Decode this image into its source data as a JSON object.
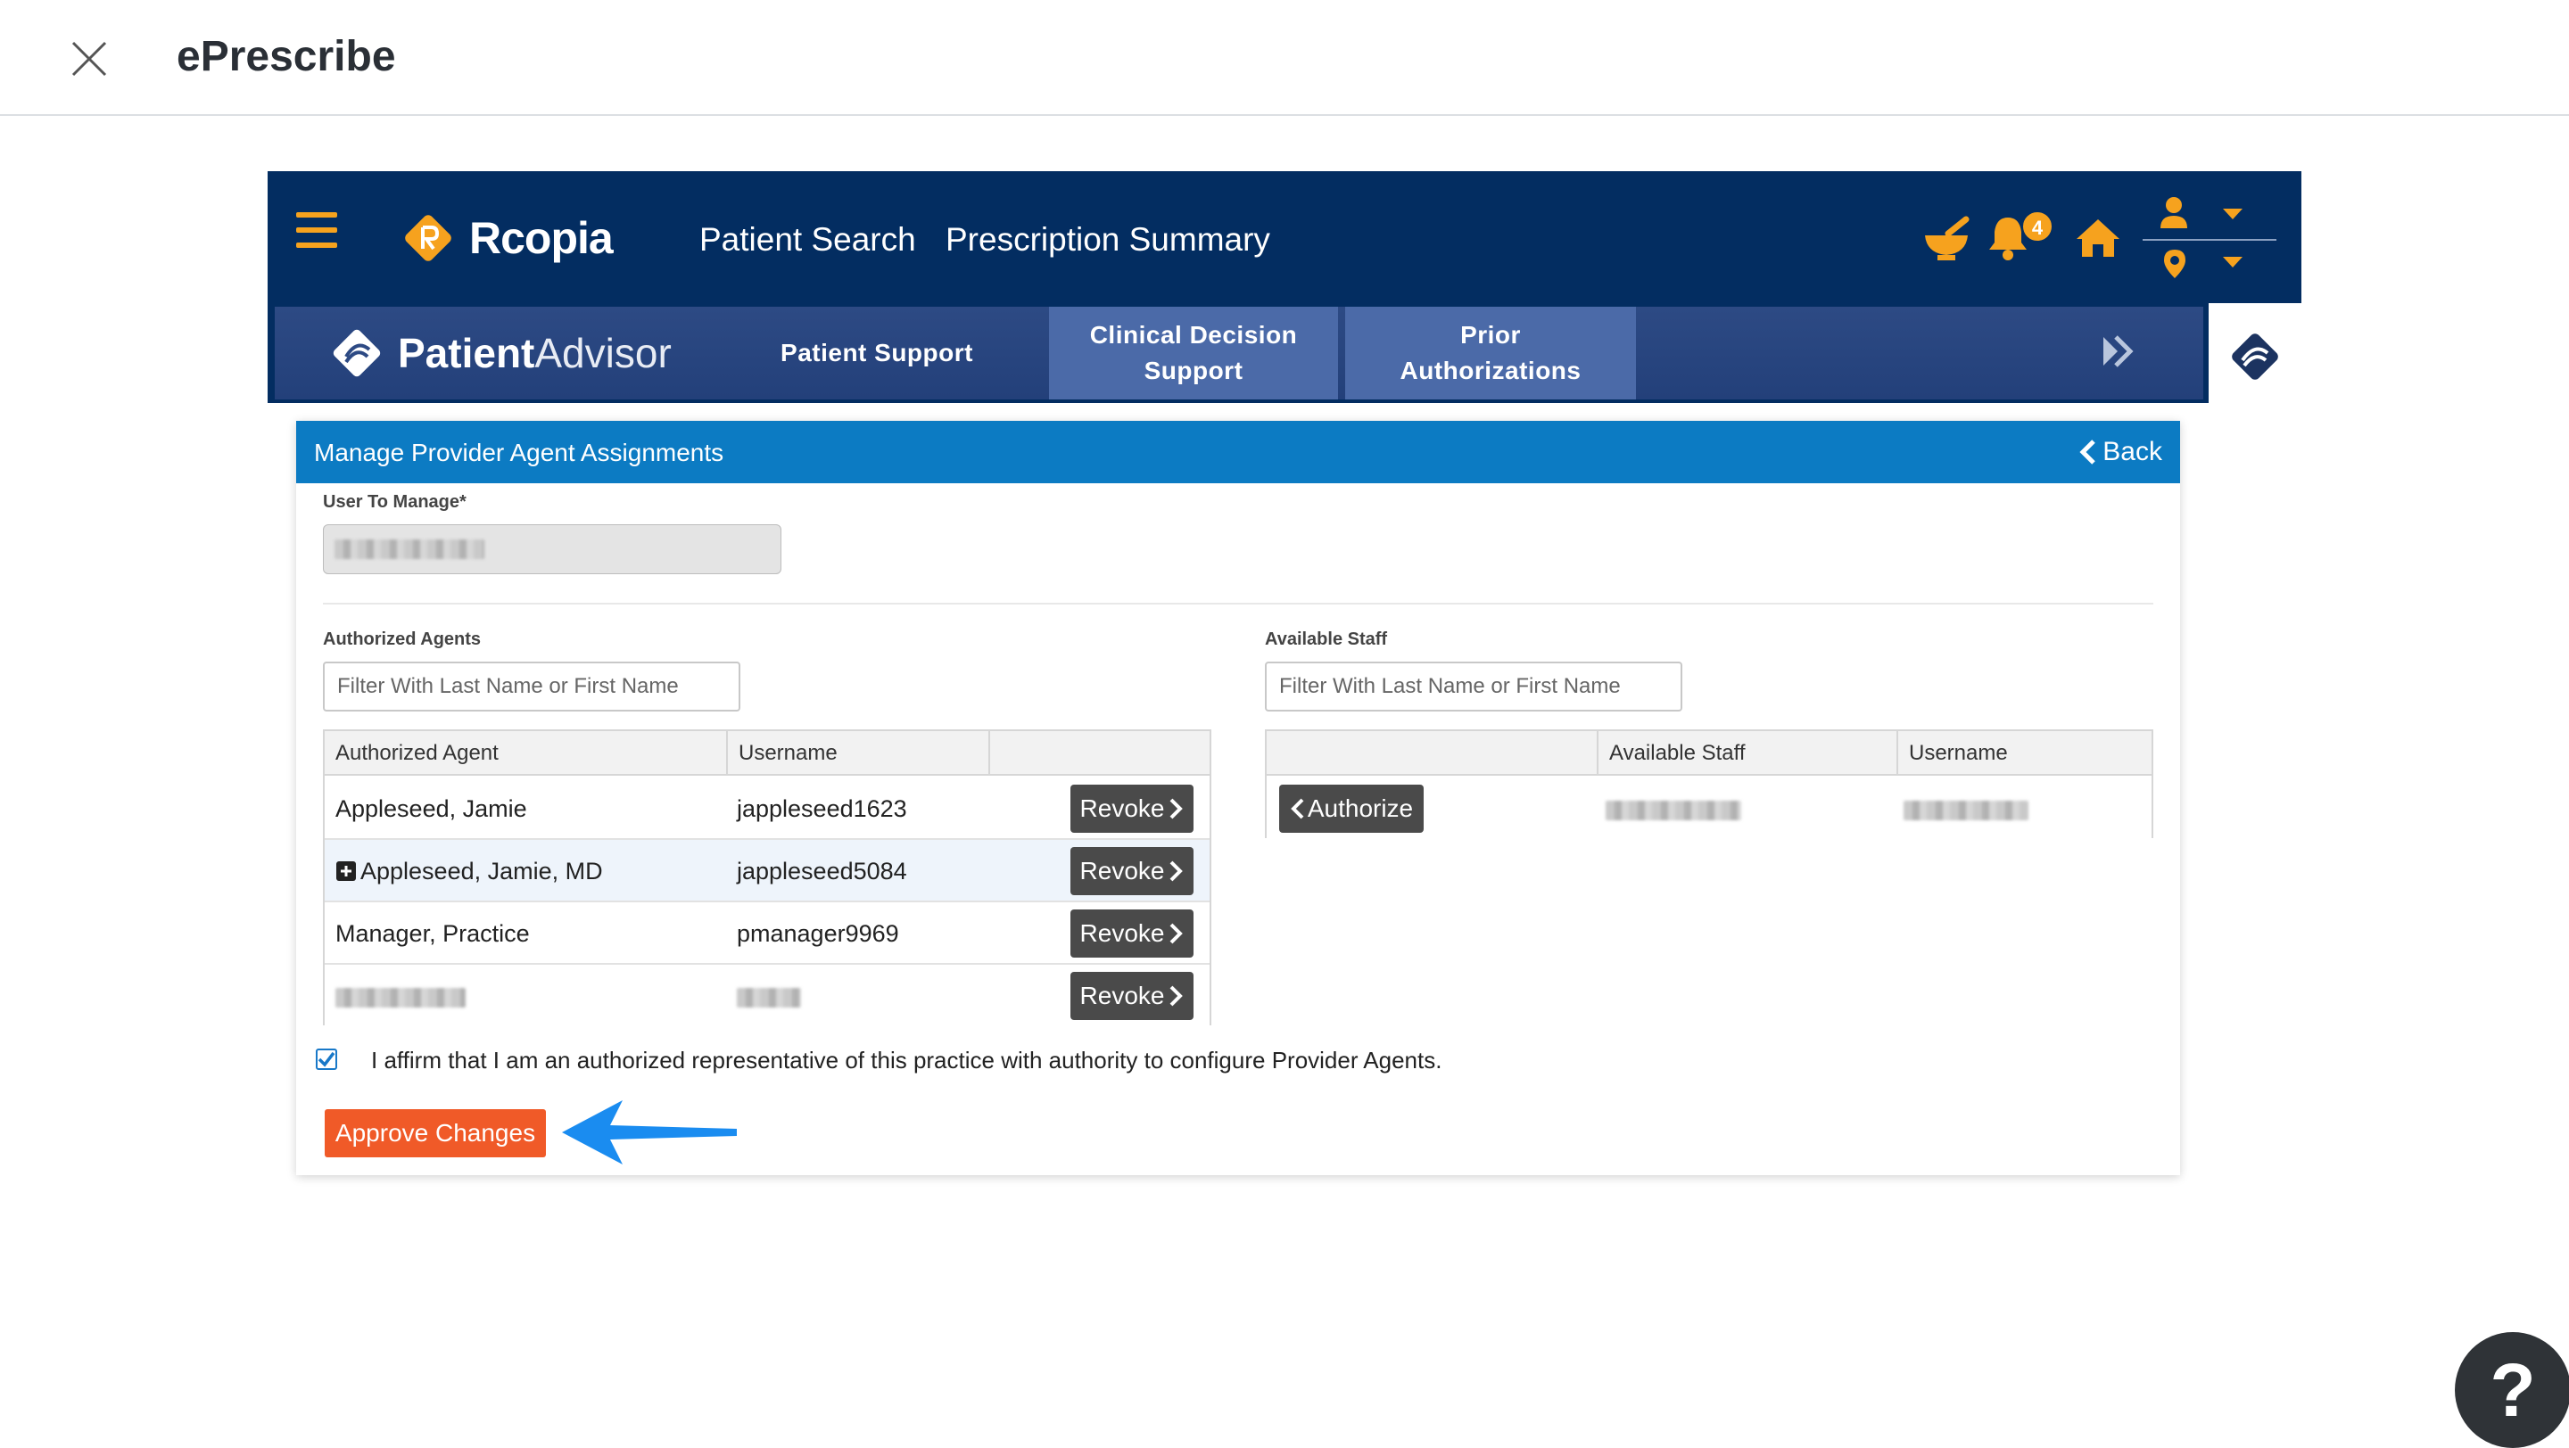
{
  "modal": {
    "title": "ePrescribe"
  },
  "topnav": {
    "brand": "Rcopia",
    "links": [
      "Patient Search",
      "Prescription Summary"
    ],
    "notification_count": "4",
    "accent": "#f6a21e",
    "bg": "#032d61"
  },
  "patient_advisor": {
    "brand_bold": "Patient",
    "brand_light": "Advisor",
    "tabs": [
      {
        "label": "Patient Support",
        "active": false
      },
      {
        "label": "Clinical Decision Support",
        "active": true
      },
      {
        "label": "Prior Authorizations",
        "active": true
      }
    ]
  },
  "card": {
    "title": "Manage Provider Agent Assignments",
    "back_label": "Back",
    "user_label": "User To Manage*",
    "authorized_agents_label": "Authorized Agents",
    "available_staff_label": "Available Staff",
    "agents_filter_placeholder": "Filter With Last Name or First Name",
    "staff_filter_placeholder": "Filter With Last Name or First Name"
  },
  "agents_table": {
    "headers": [
      "Authorized Agent",
      "Username",
      ""
    ],
    "rows": [
      {
        "name": "Appleseed, Jamie",
        "username": "jappleseed1623",
        "expandable": false
      },
      {
        "name": "Appleseed, Jamie, MD",
        "username": "jappleseed5084",
        "expandable": true
      },
      {
        "name": "Manager, Practice",
        "username": "pmanager9969",
        "expandable": false
      },
      {
        "name": "",
        "username": "",
        "expandable": false
      }
    ],
    "revoke_label": "Revoke"
  },
  "staff_table": {
    "headers": [
      "",
      "Available Staff",
      "Username"
    ],
    "authorize_label": "Authorize"
  },
  "affirm": {
    "checked": true,
    "text": "I affirm that I am an authorized representative of this practice with authority to configure Provider Agents."
  },
  "approve_label": "Approve Changes",
  "help_label": "?"
}
